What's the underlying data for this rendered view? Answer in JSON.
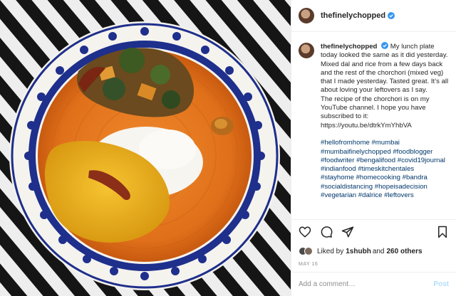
{
  "post": {
    "author": "thefinelychopped",
    "caption_author": "thefinelychopped",
    "caption_lines": [
      "My lunch plate today looked the same as it did yesterday. Mixed dal and rice from a few days back and the rest of the chorchori (mixed veg) that I made yesterday. Tasted great. It’s all about loving your leftovers as I say.",
      "The recipe of the chorchori is on my YouTube channel. I hope you have subscribed to it:",
      "https://youtu.be/dtrkYmYhbVA"
    ],
    "hashtags": "#hellofromhome #mumbai #mumbaifinelychopped #foodblogger #foodwriter #bengalifood #covid19journal #indianfood #timeskitchentales #stayhome #homecooking #bandra #socialdistancing #hopeisadecision #vegetarian #dalrice #leftovers",
    "likes_prefix": "Liked by ",
    "likes_user": "1shubh",
    "likes_middle": " and ",
    "likes_count": "260 others",
    "date": "MAY 16",
    "comment_placeholder": "Add a comment…",
    "post_button": "Post"
  },
  "icons": {
    "like": "heart-icon",
    "comment": "comment-icon",
    "share": "share-icon",
    "save": "bookmark-icon",
    "verified": "verified-badge-icon"
  },
  "colors": {
    "verified": "#3897f0",
    "hashtag": "#00376b",
    "post_button": "#b2dffc"
  }
}
